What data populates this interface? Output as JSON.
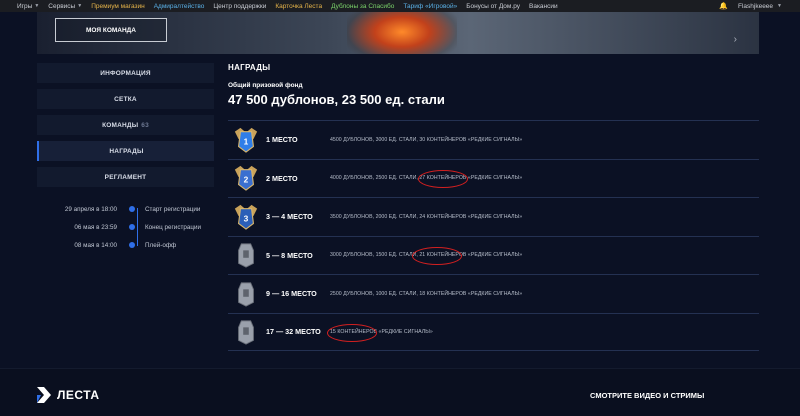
{
  "topnav": {
    "items": [
      {
        "label": "Игры",
        "dropdown": true,
        "color": "#c9ccd3"
      },
      {
        "label": "Сервисы",
        "dropdown": true,
        "color": "#c9ccd3"
      },
      {
        "label": "Премиум магазин",
        "dropdown": false,
        "color": "#e6b44a"
      },
      {
        "label": "Адмиралтейство",
        "dropdown": false,
        "color": "#5ab0e6"
      },
      {
        "label": "Центр поддержки",
        "dropdown": false,
        "color": "#c9ccd3"
      },
      {
        "label": "Карточка Леста",
        "dropdown": false,
        "color": "#e6b44a"
      },
      {
        "label": "Дублоны за Спасибо",
        "dropdown": false,
        "color": "#7bd36a"
      },
      {
        "label": "Тариф «Игровой»",
        "dropdown": false,
        "color": "#5ab0e6"
      },
      {
        "label": "Бонусы от Дом.ру",
        "dropdown": false,
        "color": "#c9ccd3"
      },
      {
        "label": "Вакансии",
        "dropdown": false,
        "color": "#c9ccd3"
      }
    ],
    "username": "Flashjkeeee"
  },
  "banner": {
    "team_button": "МОЯ КОМАНДА"
  },
  "sidebar": {
    "items": [
      {
        "label": "ИНФОРМАЦИЯ",
        "count": "",
        "active": false
      },
      {
        "label": "СЕТКА",
        "count": "",
        "active": false
      },
      {
        "label": "КОМАНДЫ",
        "count": "63",
        "active": false
      },
      {
        "label": "НАГРАДЫ",
        "count": "",
        "active": true
      },
      {
        "label": "РЕГЛАМЕНТ",
        "count": "",
        "active": false
      }
    ]
  },
  "timeline": [
    {
      "date": "29 апреля в 18:00",
      "label": "Старт регистрации"
    },
    {
      "date": "06 мая в 23:59",
      "label": "Конец регистрации"
    },
    {
      "date": "08 мая в 14:00",
      "label": "Плей-офф"
    }
  ],
  "rewards": {
    "title": "НАГРАДЫ",
    "fund_label": "Общий призовой фонд",
    "fund_value": "47 500 дублонов, 23 500 ед. стали",
    "rows": [
      {
        "medal": "1",
        "medal_color": "#2f7ee8",
        "place": "1 МЕСТО",
        "desc": "4500 ДУБЛОНОВ, 3000 ЕД. СТАЛИ, 30 КОНТЕЙНЕРОВ «РЕДКИЕ СИГНАЛЫ»"
      },
      {
        "medal": "2",
        "medal_color": "#3a6fd0",
        "place": "2 МЕСТО",
        "desc": "4000 ДУБЛОНОВ, 2500 ЕД. СТАЛИ, 27 КОНТЕЙНЕРОВ «РЕДКИЕ СИГНАЛЫ»"
      },
      {
        "medal": "3",
        "medal_color": "#2b5fb8",
        "place": "3 — 4 МЕСТО",
        "desc": "3500 ДУБЛОНОВ, 2000 ЕД. СТАЛИ, 24 КОНТЕЙНЕРОВ «РЕДКИЕ СИГНАЛЫ»"
      },
      {
        "medal": "",
        "medal_color": "#9aa0ab",
        "place": "5 — 8 МЕСТО",
        "desc": "3000 ДУБЛОНОВ, 1500 ЕД. СТАЛИ, 21 КОНТЕЙНЕРОВ «РЕДКИЕ СИГНАЛЫ»"
      },
      {
        "medal": "",
        "medal_color": "#9aa0ab",
        "place": "9 — 16 МЕСТО",
        "desc": "2500 ДУБЛОНОВ, 1000 ЕД. СТАЛИ, 18 КОНТЕЙНЕРОВ «РЕДКИЕ СИГНАЛЫ»"
      },
      {
        "medal": "",
        "medal_color": "#9aa0ab",
        "place": "17 — 32 МЕСТО",
        "desc": "15 КОНТЕЙНЕРОВ «РЕДКИЕ СИГНАЛЫ»"
      }
    ]
  },
  "footer": {
    "logo_text": "ЛЕСТА",
    "watch_label": "СМОТРИТЕ ВИДЕО И СТРИМЫ"
  },
  "colors": {
    "accent": "#2f6fe8",
    "highlight": "#d22020"
  }
}
